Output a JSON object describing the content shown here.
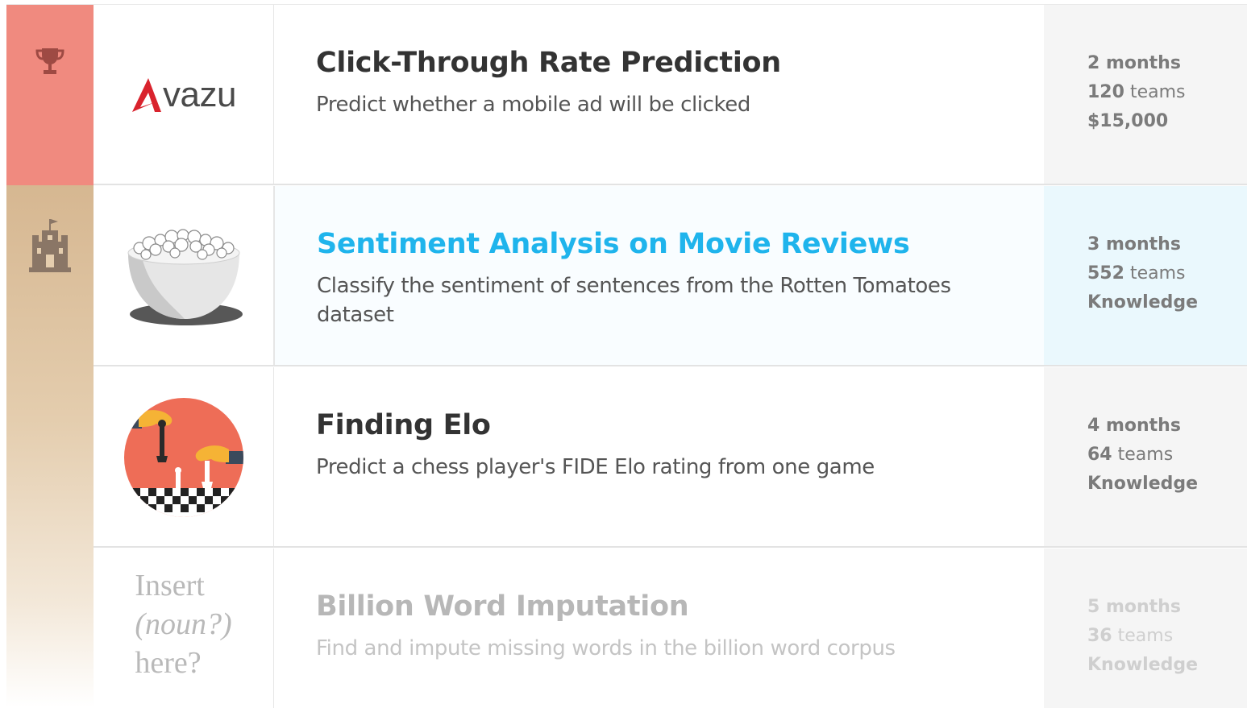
{
  "competitions": [
    {
      "logo_text": "vazu",
      "logo_letter": "A",
      "title": "Click-Through Rate Prediction",
      "description": "Predict whether a mobile ad will be clicked",
      "duration": "2 months",
      "teams_count": "120",
      "teams_label": "teams",
      "reward": "$15,000"
    },
    {
      "title": "Sentiment Analysis on Movie Reviews",
      "description": "Classify the sentiment of sentences from the Rotten Tomatoes dataset",
      "duration": "3 months",
      "teams_count": "552",
      "teams_label": "teams",
      "reward": "Knowledge"
    },
    {
      "title": "Finding Elo",
      "description": "Predict a chess player's FIDE Elo rating from one game",
      "duration": "4 months",
      "teams_count": "64",
      "teams_label": "teams",
      "reward": "Knowledge"
    },
    {
      "logo_line1": "Insert",
      "logo_line2": "(noun?)",
      "logo_line3": "here?",
      "title": "Billion Word Imputation",
      "description": "Find and impute missing words in the billion word corpus",
      "duration": "5 months",
      "teams_count": "36",
      "teams_label": "teams",
      "reward": "Knowledge"
    }
  ],
  "categories": [
    {
      "icon": "trophy-icon",
      "color": "#f08a7f"
    },
    {
      "icon": "castle-icon",
      "color": "#d6b791"
    }
  ],
  "colors": {
    "featured_title": "#1fb4ec",
    "title": "#333333",
    "meta": "#7b7b7b"
  }
}
